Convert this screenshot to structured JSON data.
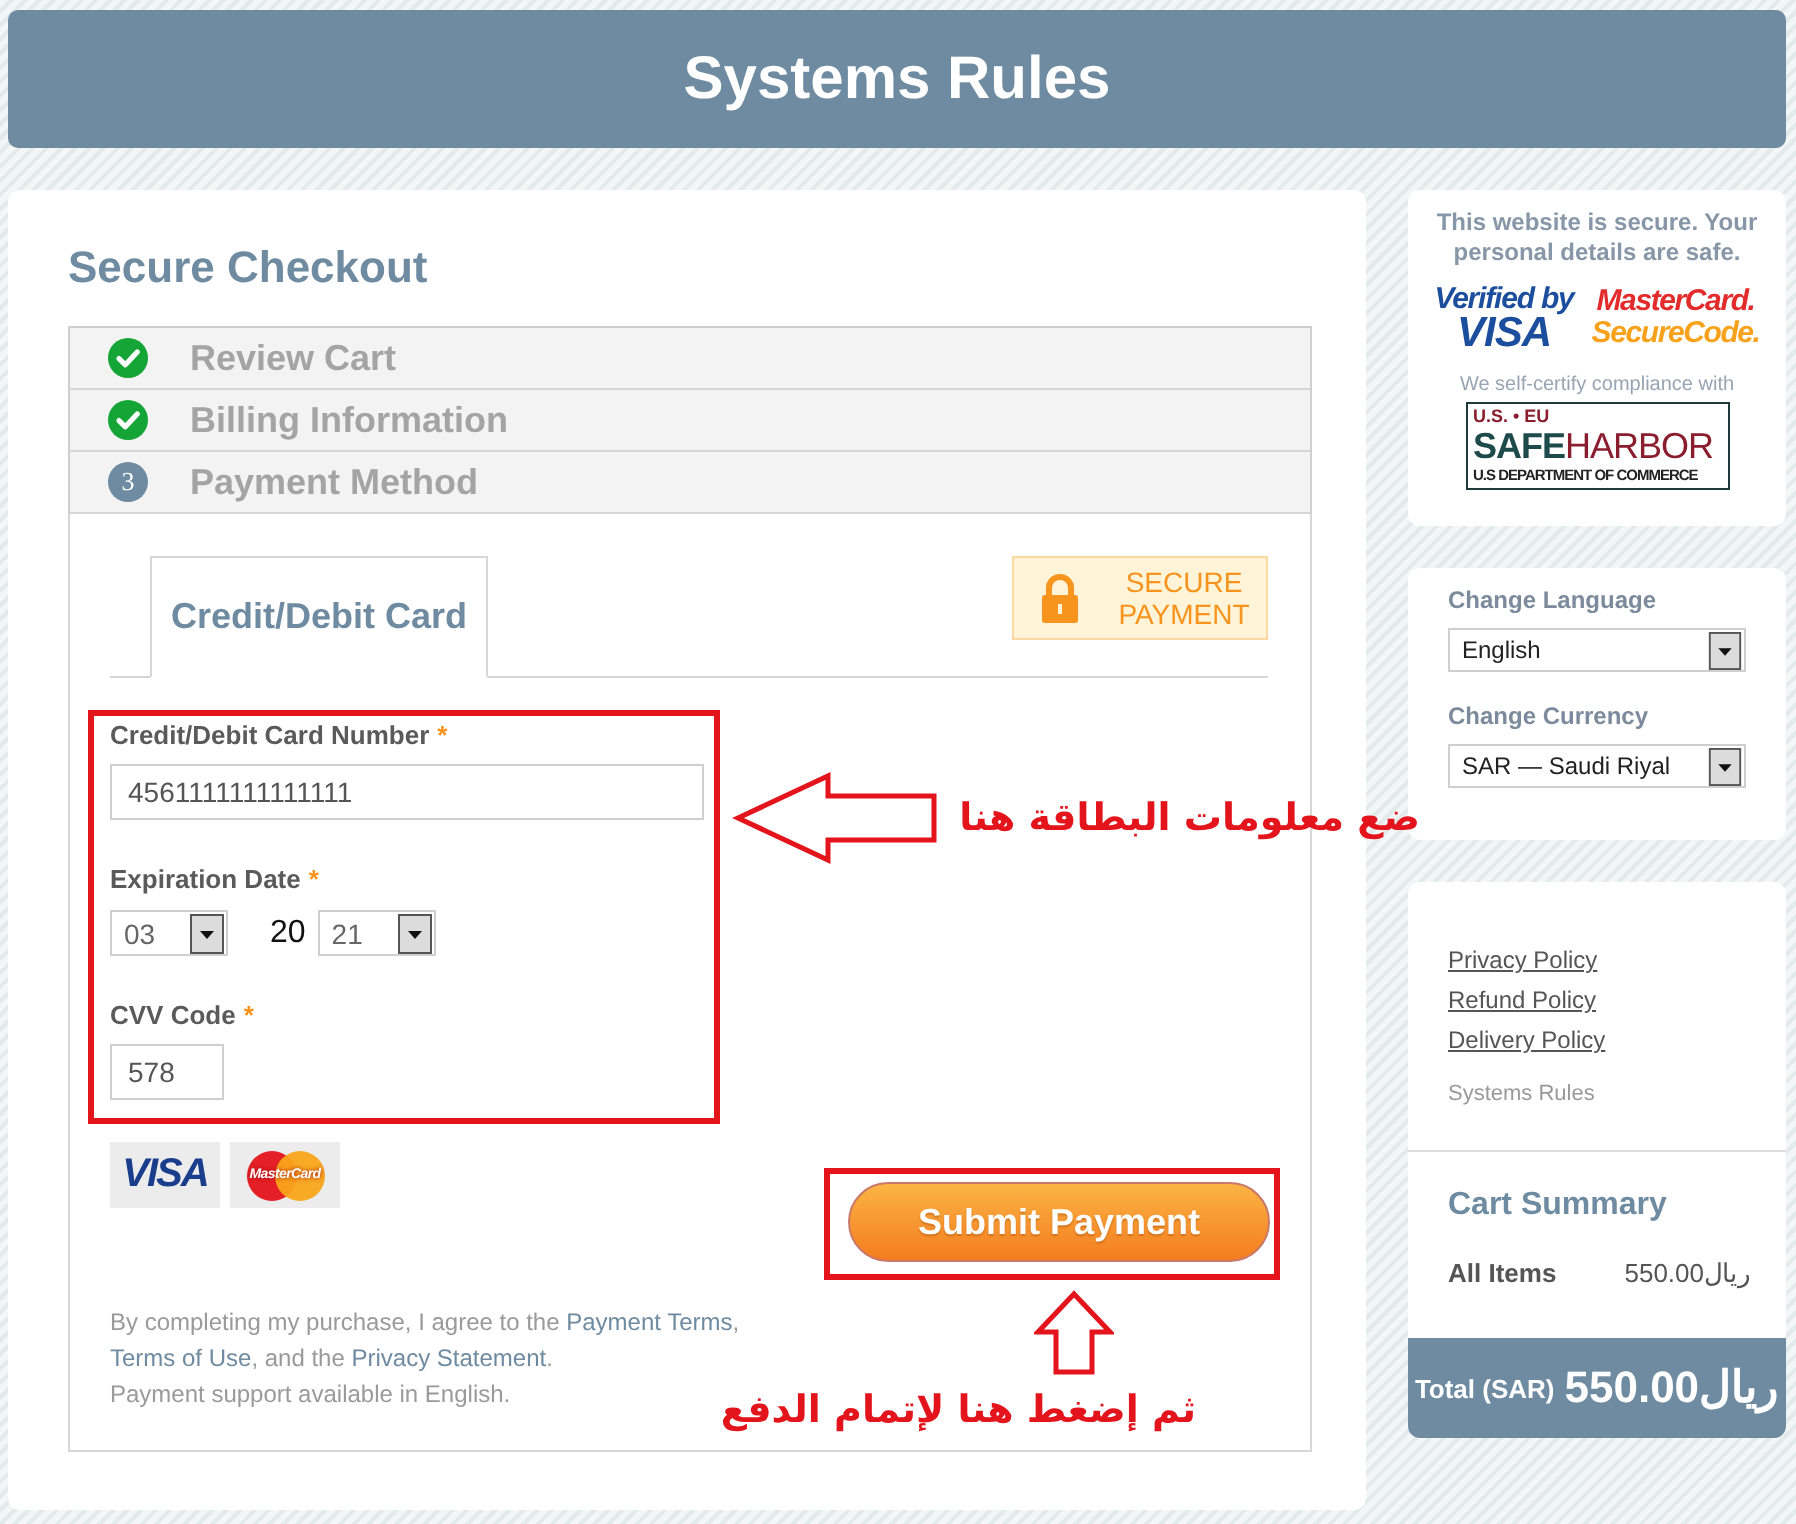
{
  "header": {
    "title": "Systems Rules"
  },
  "checkout": {
    "title": "Secure Checkout",
    "steps": [
      {
        "label": "Review Cart",
        "completed": true
      },
      {
        "label": "Billing Information",
        "completed": true
      },
      {
        "label": "Payment Method",
        "completed": false,
        "number": "3"
      }
    ],
    "tabs": [
      {
        "label": "Credit/Debit Card",
        "selected": true
      }
    ],
    "secure_badge": {
      "text": "SECURE PAYMENT"
    },
    "form": {
      "highlighted": true,
      "fields": [
        {
          "kind": "text",
          "label": "Credit/Debit Card Number",
          "required_mark": "*",
          "value": "4561111111111111"
        },
        {
          "kind": "expiry",
          "label": "Expiration Date",
          "required_mark": "*",
          "month": "03",
          "year_prefix": "20",
          "year": "21"
        },
        {
          "kind": "short_text",
          "label": "CVV Code",
          "required_mark": "*",
          "value": "578"
        }
      ]
    },
    "card_logos": [
      {
        "kind": "visa",
        "text": "VISA"
      },
      {
        "kind": "mastercard",
        "text": "MasterCard"
      }
    ],
    "terms": [
      {
        "kind": "text",
        "text": "By completing my purchase, I agree to the "
      },
      {
        "kind": "link",
        "text": "Payment Terms"
      },
      {
        "kind": "text",
        "text": ", "
      },
      {
        "kind": "link",
        "text": "Terms of Use"
      },
      {
        "kind": "text",
        "text": ", and the "
      },
      {
        "kind": "link",
        "text": "Privacy Statement"
      },
      {
        "kind": "text",
        "text": "."
      }
    ],
    "support_note": "Payment support available in English.",
    "submit": {
      "label": "Submit Payment",
      "highlighted": true
    }
  },
  "annotations": [
    {
      "kind": "arrow_left",
      "text": "ضع معلومات البطاقة هنا"
    },
    {
      "kind": "arrow_up",
      "text": "ثم إضغط هنا لإتمام الدفع"
    }
  ],
  "security": {
    "message": "This website is secure. Your personal details are safe.",
    "badges": [
      {
        "kind": "visa_verified",
        "lines": [
          "Verified by",
          "VISA"
        ]
      },
      {
        "kind": "securecode",
        "lines": [
          "MasterCard.",
          "SecureCode."
        ]
      }
    ],
    "compliance_note": "We self-certify compliance with",
    "seal": {
      "top": "U.S. • EU",
      "name": "**SAFE**HARBOR",
      "bottom": "U.S DEPARTMENT OF COMMERCE"
    }
  },
  "preferences": [
    {
      "label": "Change Language",
      "value": "English"
    },
    {
      "label": "Change Currency",
      "value": "SAR — Saudi Riyal"
    }
  ],
  "policies": {
    "links": [
      "Privacy Policy",
      "Refund Policy",
      "Delivery Policy"
    ],
    "company": "Systems Rules"
  },
  "cart_summary": {
    "title": "Cart Summary",
    "rows": [
      {
        "label": "All Items",
        "amount": "550.00ريال"
      }
    ],
    "total_label": "Total (SAR)",
    "total_amount": "550.00ريال"
  }
}
